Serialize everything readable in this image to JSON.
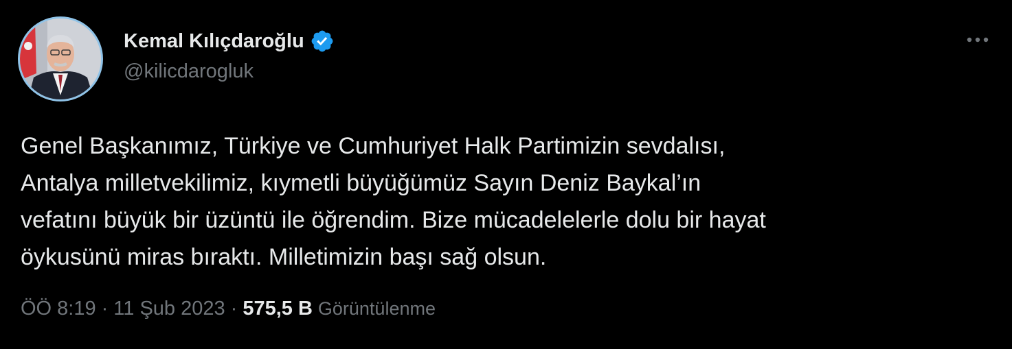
{
  "tweet": {
    "author": {
      "display_name": "Kemal Kılıçdaroğlu",
      "handle": "@kilicdarogluk",
      "verified": true,
      "verified_color": "#1d9bf0",
      "avatar_icon": "profile-photo"
    },
    "menu_icon": "more-options-icon",
    "text_lines": [
      "Genel Başkanımız, Türkiye ve Cumhuriyet Halk Partimizin sevdalısı,",
      "Antalya milletvekilimiz, kıymetli büyüğümüz Sayın Deniz Baykal’ın",
      "vefatını büyük bir üzüntü ile öğrendim. Bize mücadelelerle dolu bir hayat",
      "öykusünü miras bıraktı. Milletimizin başı sağ olsun."
    ],
    "meta": {
      "time": "ÖÖ 8:19",
      "separator": "·",
      "date": "11 Şub 2023",
      "views_count": "575,5 B",
      "views_label": "Görüntülenme"
    }
  },
  "colors": {
    "background": "#000000",
    "primary_text": "#e7e9ea",
    "secondary_text": "#71767b",
    "avatar_border": "#8fc3e8"
  }
}
